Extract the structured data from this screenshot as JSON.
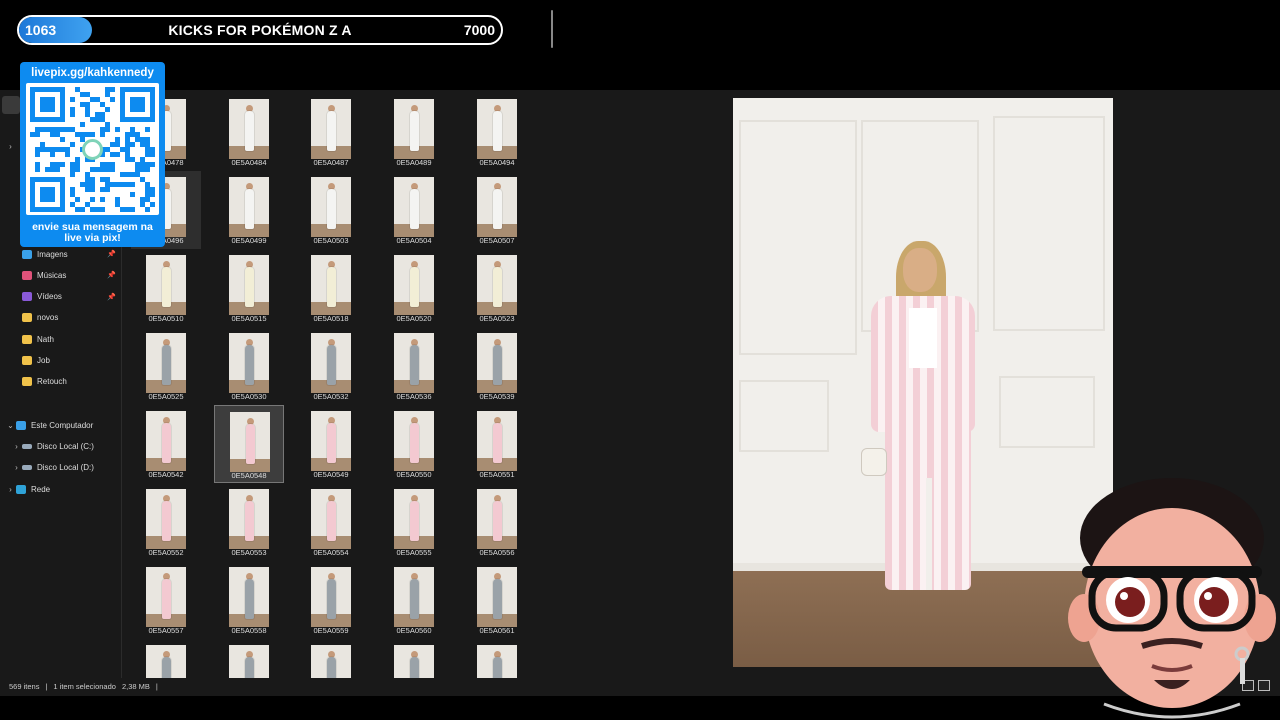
{
  "stream_goal": {
    "current": "1063",
    "title": "KICKS FOR POKÉMON Z A",
    "target": "7000",
    "progress_fraction": 0.152
  },
  "qr_overlay": {
    "url": "livepix.gg/kahkennedy",
    "caption_line1": "envie sua mensagem na",
    "caption_line2": "live via pix!"
  },
  "nav": {
    "quick_access": [
      {
        "label": "Imagens",
        "icon": "images-icon",
        "pinned": true
      },
      {
        "label": "Músicas",
        "icon": "music-icon",
        "pinned": true
      },
      {
        "label": "Vídeos",
        "icon": "videos-icon",
        "pinned": true
      },
      {
        "label": "novos",
        "icon": "folder-icon",
        "pinned": false
      },
      {
        "label": "Nath",
        "icon": "folder-icon",
        "pinned": false
      },
      {
        "label": "Job",
        "icon": "folder-icon",
        "pinned": false
      },
      {
        "label": "Retouch",
        "icon": "folder-icon",
        "pinned": false
      }
    ],
    "this_pc": "Este Computador",
    "drives": [
      "Disco Local (C:)",
      "Disco Local (D:)"
    ],
    "network": "Rede",
    "pin_glyph": "📌",
    "expanded_chevron": "⌄",
    "collapsed_chevron": "›"
  },
  "files": [
    {
      "name": "0E5A0478",
      "outfit": "white"
    },
    {
      "name": "0E5A0484",
      "outfit": "white"
    },
    {
      "name": "0E5A0487",
      "outfit": "white"
    },
    {
      "name": "0E5A0489",
      "outfit": "white"
    },
    {
      "name": "0E5A0494",
      "outfit": "white"
    },
    {
      "name": "0E5A0496",
      "outfit": "white"
    },
    {
      "name": "0E5A0499",
      "outfit": "white"
    },
    {
      "name": "0E5A0503",
      "outfit": "white"
    },
    {
      "name": "0E5A0504",
      "outfit": "white"
    },
    {
      "name": "0E5A0507",
      "outfit": "white"
    },
    {
      "name": "0E5A0510",
      "outfit": "cream"
    },
    {
      "name": "0E5A0515",
      "outfit": "cream"
    },
    {
      "name": "0E5A0518",
      "outfit": "cream"
    },
    {
      "name": "0E5A0520",
      "outfit": "cream"
    },
    {
      "name": "0E5A0523",
      "outfit": "cream"
    },
    {
      "name": "0E5A0525",
      "outfit": "grey"
    },
    {
      "name": "0E5A0530",
      "outfit": "grey"
    },
    {
      "name": "0E5A0532",
      "outfit": "grey"
    },
    {
      "name": "0E5A0536",
      "outfit": "grey"
    },
    {
      "name": "0E5A0539",
      "outfit": "grey"
    },
    {
      "name": "0E5A0542",
      "outfit": "pink"
    },
    {
      "name": "0E5A0548",
      "outfit": "pink",
      "selected": true
    },
    {
      "name": "0E5A0549",
      "outfit": "pink"
    },
    {
      "name": "0E5A0550",
      "outfit": "pink"
    },
    {
      "name": "0E5A0551",
      "outfit": "pink"
    },
    {
      "name": "0E5A0552",
      "outfit": "pink"
    },
    {
      "name": "0E5A0553",
      "outfit": "pink"
    },
    {
      "name": "0E5A0554",
      "outfit": "pink"
    },
    {
      "name": "0E5A0555",
      "outfit": "pink"
    },
    {
      "name": "0E5A0556",
      "outfit": "pink"
    },
    {
      "name": "0E5A0557",
      "outfit": "pink"
    },
    {
      "name": "0E5A0558",
      "outfit": "grey"
    },
    {
      "name": "0E5A0559",
      "outfit": "grey"
    },
    {
      "name": "0E5A0560",
      "outfit": "grey"
    },
    {
      "name": "0E5A0561",
      "outfit": "grey"
    },
    {
      "name": "",
      "outfit": "grey"
    },
    {
      "name": "",
      "outfit": "grey"
    },
    {
      "name": "",
      "outfit": "grey"
    },
    {
      "name": "",
      "outfit": "grey"
    },
    {
      "name": "",
      "outfit": "grey"
    }
  ],
  "outfit_colors": {
    "white": "#f4f4f2",
    "cream": "#f2eed6",
    "grey": "#9aa2a8",
    "pink": "#f3c9d1"
  },
  "status": {
    "item_count": "569 itens",
    "selection": "1 item selecionado",
    "size": "2,38 MB"
  },
  "colors": {
    "accent": "#0d8bf0",
    "background": "#191919"
  }
}
